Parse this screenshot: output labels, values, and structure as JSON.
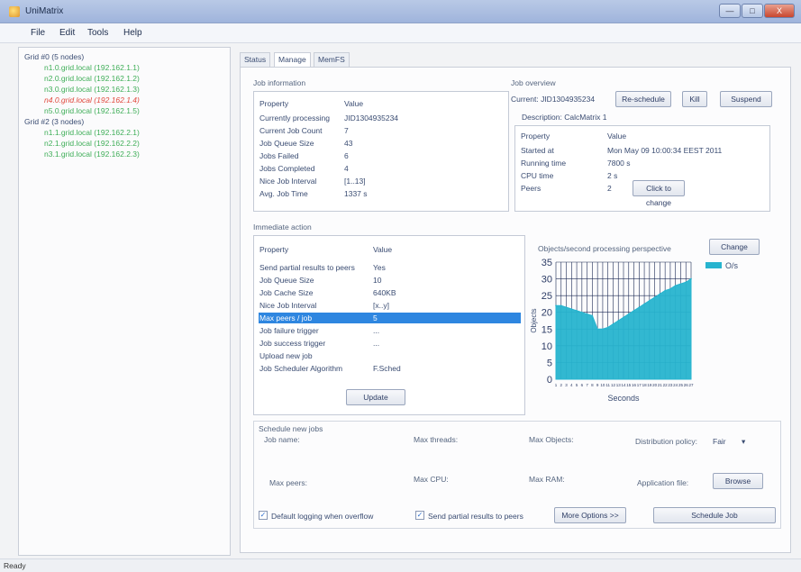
{
  "window": {
    "title": "UniMatrix",
    "min": "—",
    "max": "□",
    "close": "X"
  },
  "menu": [
    "File",
    "Edit",
    "Tools",
    "Help"
  ],
  "tree": [
    {
      "text": "Grid #0 (5 nodes)",
      "kind": "group"
    },
    {
      "text": "n1.0.grid.local (192.162.1.1)",
      "kind": "ok"
    },
    {
      "text": "n2.0.grid.local (192.162.1.2)",
      "kind": "ok"
    },
    {
      "text": "n3.0.grid.local (192.162.1.3)",
      "kind": "ok"
    },
    {
      "text": "n4.0.grid.local (192.162.1.4)",
      "kind": "err"
    },
    {
      "text": "n5.0.grid.local (192.162.1.5)",
      "kind": "ok"
    },
    {
      "text": "Grid #2 (3 nodes)",
      "kind": "group"
    },
    {
      "text": "n1.1.grid.local (192.162.2.1)",
      "kind": "ok"
    },
    {
      "text": "n2.1.grid.local (192.162.2.2)",
      "kind": "ok"
    },
    {
      "text": "n3.1.grid.local (192.162.2.3)",
      "kind": "ok"
    }
  ],
  "tabs": [
    "Status",
    "Manage",
    "MemFS"
  ],
  "job_info": {
    "title": "Job information",
    "header": [
      "Property",
      "Value"
    ],
    "rows": [
      [
        "Currently processing",
        "JID1304935234"
      ],
      [
        "Current Job Count",
        "7"
      ],
      [
        "Job Queue Size",
        "43"
      ],
      [
        "Jobs Failed",
        "6"
      ],
      [
        "Jobs Completed",
        "4"
      ],
      [
        "Nice Job Interval",
        "[1..13]"
      ],
      [
        "Avg. Job Time",
        "1337 s"
      ]
    ]
  },
  "job_overview": {
    "title": "Job overview",
    "current_label": "Current: JID1304935234",
    "reschedule": "Re-schedule",
    "kill": "Kill",
    "suspend": "Suspend",
    "description": "Description: CalcMatrix 1",
    "header": [
      "Property",
      "Value"
    ],
    "rows": [
      [
        "Started at",
        "Mon May 09 10:00:34 EEST 2011"
      ],
      [
        "Running time",
        "7800 s"
      ],
      [
        "CPU time",
        "2 s"
      ],
      [
        "Peers",
        "2"
      ]
    ],
    "click_to_change": "Click to change"
  },
  "immediate": {
    "title": "Immediate action",
    "header": [
      "Property",
      "Value"
    ],
    "rows": [
      [
        "Send partial results to peers",
        "Yes"
      ],
      [
        "Job Queue Size",
        "10"
      ],
      [
        "Job Cache Size",
        "640KB"
      ],
      [
        "Nice Job Interval",
        "[x..y]"
      ],
      [
        "Max peers / job",
        "5"
      ],
      [
        "Job failure trigger",
        "..."
      ],
      [
        "Job success trigger",
        "..."
      ],
      [
        "Upload new job",
        ""
      ],
      [
        "Job Scheduler Algorithm",
        "F.Sched"
      ]
    ],
    "selected_index": 4,
    "update": "Update"
  },
  "chart_panel": {
    "caption": "Objects/second processing perspective",
    "change": "Change"
  },
  "chart_data": {
    "type": "area",
    "xlabel": "Seconds",
    "ylabel": "Objects",
    "ylim": [
      0,
      35
    ],
    "yticks": [
      0,
      5,
      10,
      15,
      20,
      25,
      30,
      35
    ],
    "legend": [
      "O/s"
    ],
    "x": [
      1,
      2,
      3,
      4,
      5,
      6,
      7,
      8,
      9,
      10,
      11,
      12,
      13,
      14,
      15,
      16,
      17,
      18,
      19,
      20,
      21,
      22,
      23,
      24,
      25,
      26,
      27
    ],
    "series": [
      {
        "name": "O/s",
        "color": "#27b4cf",
        "values": [
          22,
          22,
          21.5,
          21,
          20.5,
          20,
          19.5,
          19,
          15,
          15,
          15.5,
          16.5,
          17.5,
          18.5,
          19.5,
          20.5,
          21.5,
          22.5,
          23.5,
          24.5,
          25.5,
          26.5,
          27,
          28,
          28.5,
          29,
          30
        ]
      }
    ]
  },
  "schedule": {
    "title": "Schedule new jobs",
    "job_name": "Job name:",
    "max_threads": "Max threads:",
    "max_objects": "Max Objects:",
    "distribution_policy": "Distribution policy:",
    "policy_value": "Fair",
    "max_peers": "Max peers:",
    "max_cpu": "Max CPU:",
    "max_ram": "Max RAM:",
    "app_file": "Application file:",
    "browse": "Browse",
    "default_logging": "Default logging when overflow",
    "send_partial": "Send partial results to peers",
    "more_options": "More Options >>",
    "schedule_job": "Schedule Job"
  },
  "status": "Ready"
}
